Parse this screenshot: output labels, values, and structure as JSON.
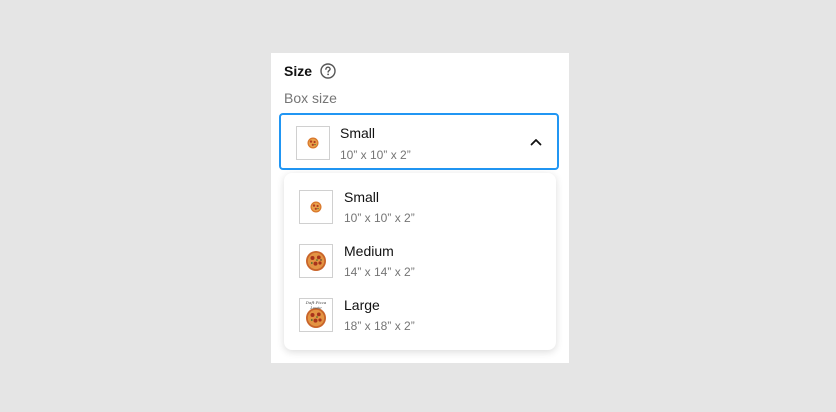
{
  "field": {
    "title": "Size",
    "help_icon": "question-circle-icon",
    "label": "Box size"
  },
  "select": {
    "selected_name": "Small",
    "selected_dims": "10” x 10” x 2”",
    "chevron_icon": "chevron-up-icon",
    "accent_color": "#2196f3"
  },
  "options": [
    {
      "name": "Small",
      "dims": "10” x 10” x 2”",
      "icon": "pizza-small-icon"
    },
    {
      "name": "Medium",
      "dims": "14” x 14” x 2”",
      "icon": "pizza-medium-icon"
    },
    {
      "name": "Large",
      "dims": "18” x 18” x 2”",
      "icon": "pizza-large-icon",
      "logo_text": "Daft Pizza Louie"
    }
  ]
}
